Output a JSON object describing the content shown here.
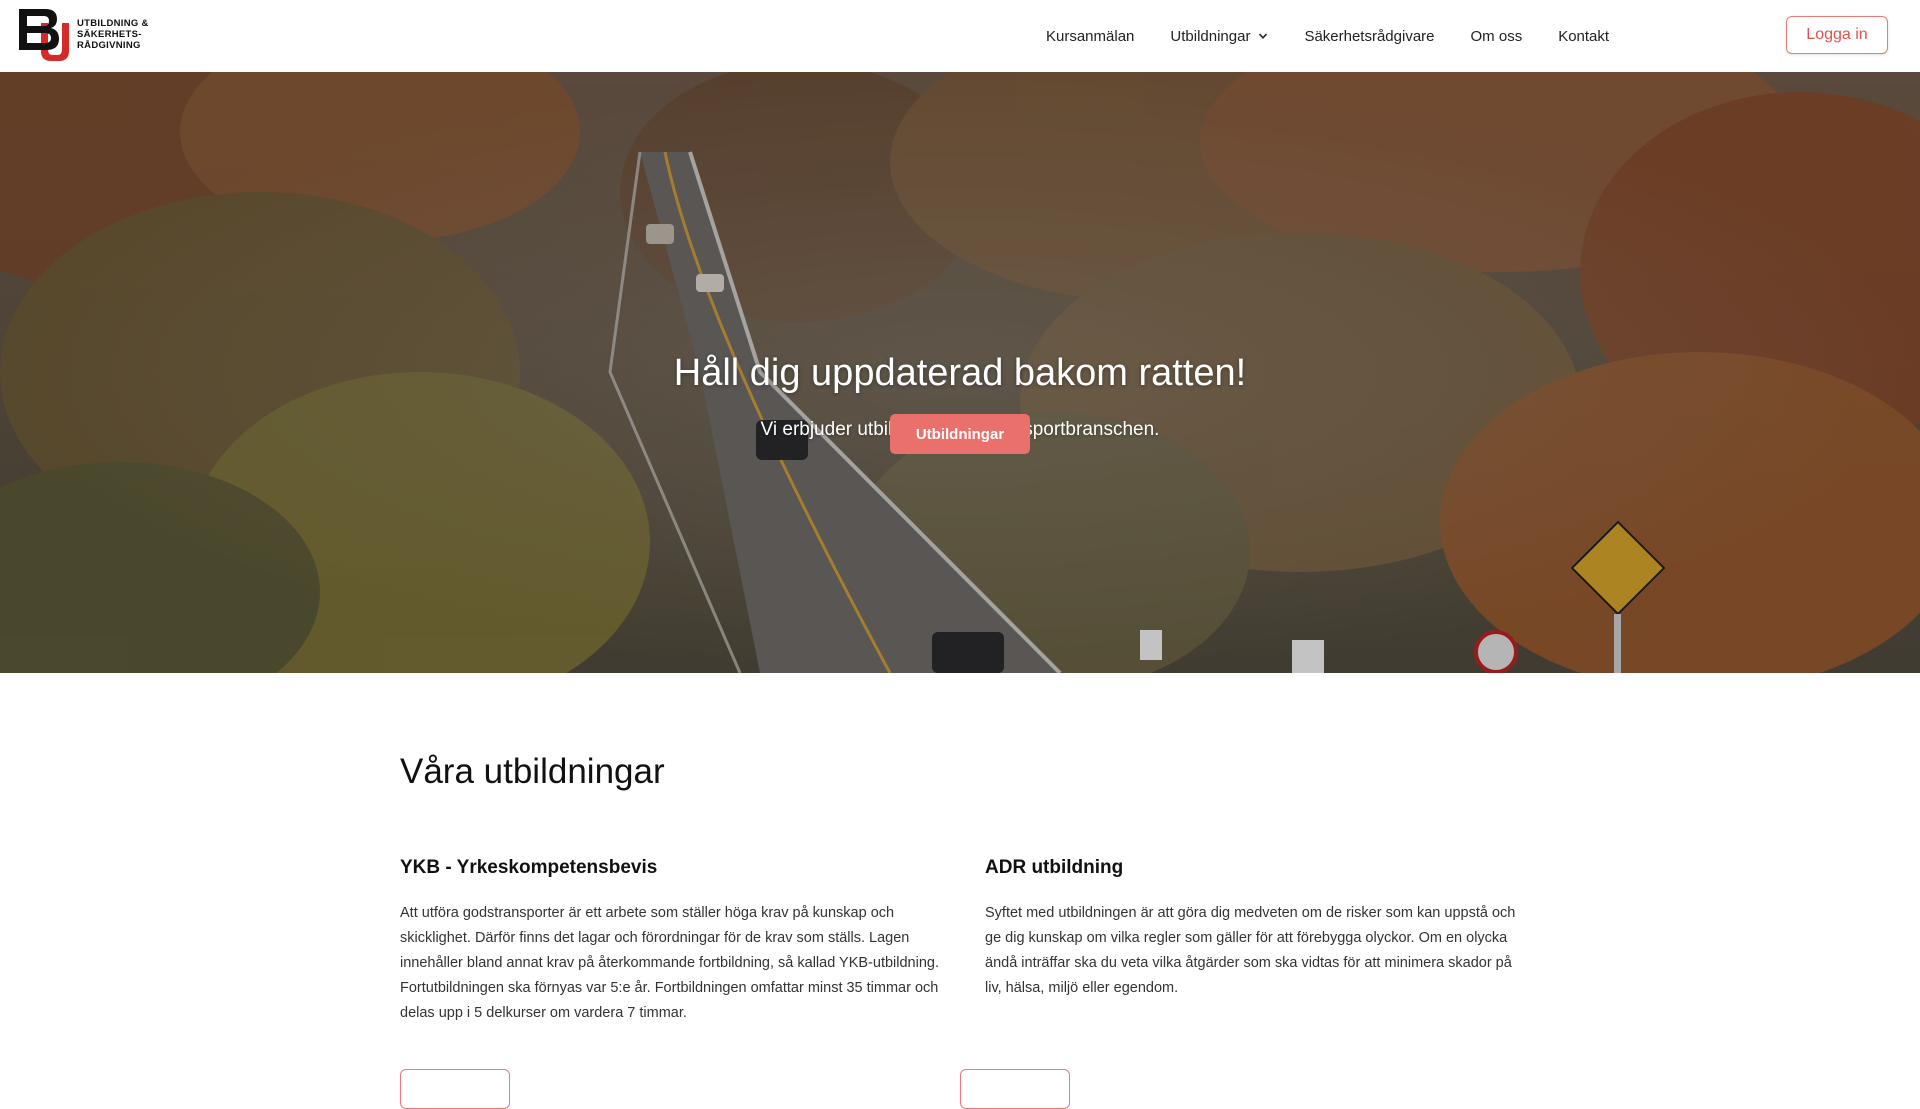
{
  "logo": {
    "mark_letters": "BU",
    "lines": [
      "UTBILDNING &",
      "SÄKERHETS-",
      "RÅDGIVNING"
    ]
  },
  "nav": {
    "items": [
      "Kursanmälan",
      "Utbildningar",
      "Säkerhetsrådgivare",
      "Om oss",
      "Kontakt"
    ],
    "dropdown_icon": "chevron-down-icon",
    "login_label": "Logga in"
  },
  "hero": {
    "title": "Håll dig uppdaterad bakom ratten!",
    "subtitle": "Vi erbjuder utbildning inom transportbranschen.",
    "button_label": "Utbildningar"
  },
  "main": {
    "section_title": "Våra utbildningar",
    "cards": [
      {
        "title": "YKB - Yrkeskompetensbevis",
        "text": "Att utföra godstransporter är ett arbete som ställer höga krav på kunskap och skicklighet. Därför finns det lagar och förordningar för de krav som ställs. Lagen innehåller bland annat krav på återkommande fortbildning, så kallad YKB-utbildning. Fortutbildningen ska förnyas var 5:e år. Fortbildningen omfattar minst 35 timmar och delas upp i 5 delkurser om vardera 7 timmar."
      },
      {
        "title": "ADR utbildning",
        "text": "Syftet med utbildningen är att göra dig medveten om de risker som kan uppstå och ge dig kunskap om vilka regler som gäller för att förebygga olyckor. Om en olycka ändå inträffar ska du veta vilka åtgärder som ska vidtas för att minimera skador på liv, hälsa, miljö eller egendom."
      }
    ]
  },
  "colors": {
    "accent": "#ea706c",
    "accent_border": "#e97a76",
    "logo_red": "#d42a2a"
  }
}
